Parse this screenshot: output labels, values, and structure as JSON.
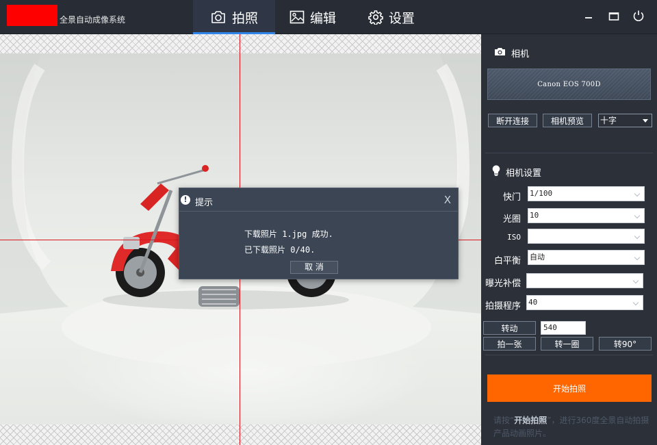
{
  "app": {
    "title": "全景自动成像系统"
  },
  "nav": {
    "tabs": [
      {
        "label": "拍照",
        "icon": "camera-icon",
        "active": true
      },
      {
        "label": "编辑",
        "icon": "image-icon",
        "active": false
      },
      {
        "label": "设置",
        "icon": "gear-icon",
        "active": false
      }
    ]
  },
  "dialog": {
    "title": "提示",
    "close": "X",
    "message1": "下载照片 1.jpg 成功.",
    "message2": "已下载照片 0/40.",
    "cancel": "取 消"
  },
  "panel": {
    "camera_header": "相机",
    "camera_model": "Canon EOS 700D",
    "disconnect": "断开连接",
    "preview": "相机预览",
    "crosshair_option": "十字",
    "settings_header": "相机设置",
    "settings": [
      {
        "label": "快门",
        "value": "1/100"
      },
      {
        "label": "光圈",
        "value": "10"
      },
      {
        "label": "ISO",
        "value": ""
      },
      {
        "label": "白平衡",
        "value": "自动"
      },
      {
        "label": "曝光补偿",
        "value": ""
      },
      {
        "label": "拍摄程序",
        "value": "40"
      }
    ],
    "rotate_label": "转动",
    "rotate_value": "540",
    "one_shot": "拍一张",
    "one_round": "转一圈",
    "rotate90": "转90°",
    "start": "开始拍照",
    "hint_pre": "请按“",
    "hint_bold": "开始拍照",
    "hint_post": "”，进行360度全景自动拍摄产品动画照片。"
  },
  "colors": {
    "accent": "#ff6600",
    "active_tab_underline": "#2f86e8",
    "crosshair": "#d9161e",
    "logo_block": "#ff0000"
  }
}
